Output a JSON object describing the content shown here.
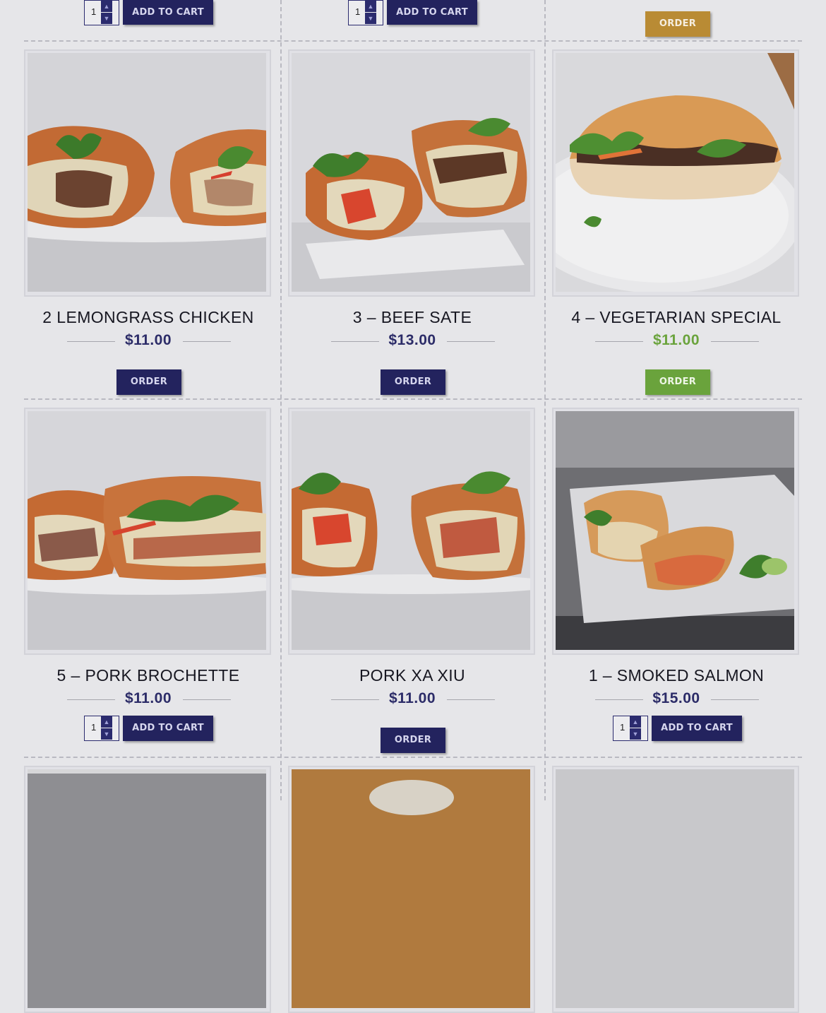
{
  "colors": {
    "accent_navy": "#23235e",
    "price_navy": "#2c2c68",
    "gold_button": "#b98b34",
    "green_button": "#6aa33c"
  },
  "icons": {
    "qty_up": "chevron-up-icon",
    "qty_down": "chevron-down-icon"
  },
  "top_row": {
    "col1": {
      "qty": "1",
      "cart_label": "ADD TO CART"
    },
    "col2": {
      "qty": "1",
      "cart_label": "ADD TO CART"
    },
    "col3": {
      "order_label": "ORDER"
    }
  },
  "row1": [
    {
      "name": "2 LEMONGRASS CHICKEN",
      "price": "$11.00",
      "action": "ORDER"
    },
    {
      "name": "3 – BEEF SATE",
      "price": "$13.00",
      "action": "ORDER"
    },
    {
      "name": "4 – VEGETARIAN SPECIAL",
      "price": "$11.00",
      "action": "ORDER"
    }
  ],
  "row2": [
    {
      "name": "5 – PORK BROCHETTE",
      "price": "$11.00",
      "qty": "1",
      "action": "ADD TO CART"
    },
    {
      "name": "PORK XA XIU",
      "price": "$11.00",
      "action": "ORDER"
    },
    {
      "name": "1 – SMOKED SALMON",
      "price": "$15.00",
      "qty": "1",
      "action": "ADD TO CART"
    }
  ]
}
